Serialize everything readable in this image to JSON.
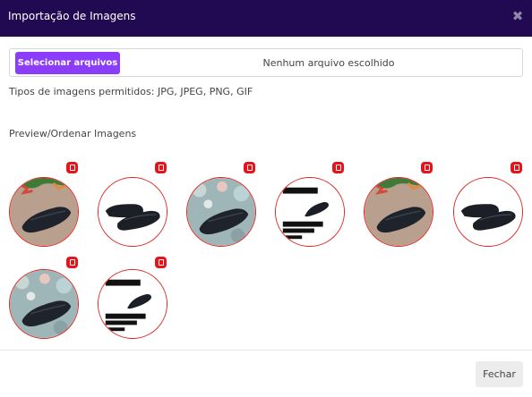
{
  "modal": {
    "title": "Importação de Imagens"
  },
  "upload": {
    "button_label": "Selecionar arquivos",
    "status_text": "Nenhum arquivo escolhido"
  },
  "allowed_types": "Tipos de imagens permitidos: JPG, JPEG, PNG, GIF",
  "preview_label": "Preview/Ordenar Imagens",
  "images": [
    {
      "style": "wood-shoe"
    },
    {
      "style": "white-shoe"
    },
    {
      "style": "bokeh-shoe"
    },
    {
      "style": "promo-shoe"
    },
    {
      "style": "wood-shoe"
    },
    {
      "style": "white-shoe"
    },
    {
      "style": "bokeh-shoe"
    },
    {
      "style": "promo-shoe"
    }
  ],
  "footer": {
    "close_label": "Fechar"
  },
  "colors": {
    "header": "#220a52",
    "accent": "#8b3dfa",
    "delete": "#e5141b",
    "thumb_border": "#e0241f"
  }
}
